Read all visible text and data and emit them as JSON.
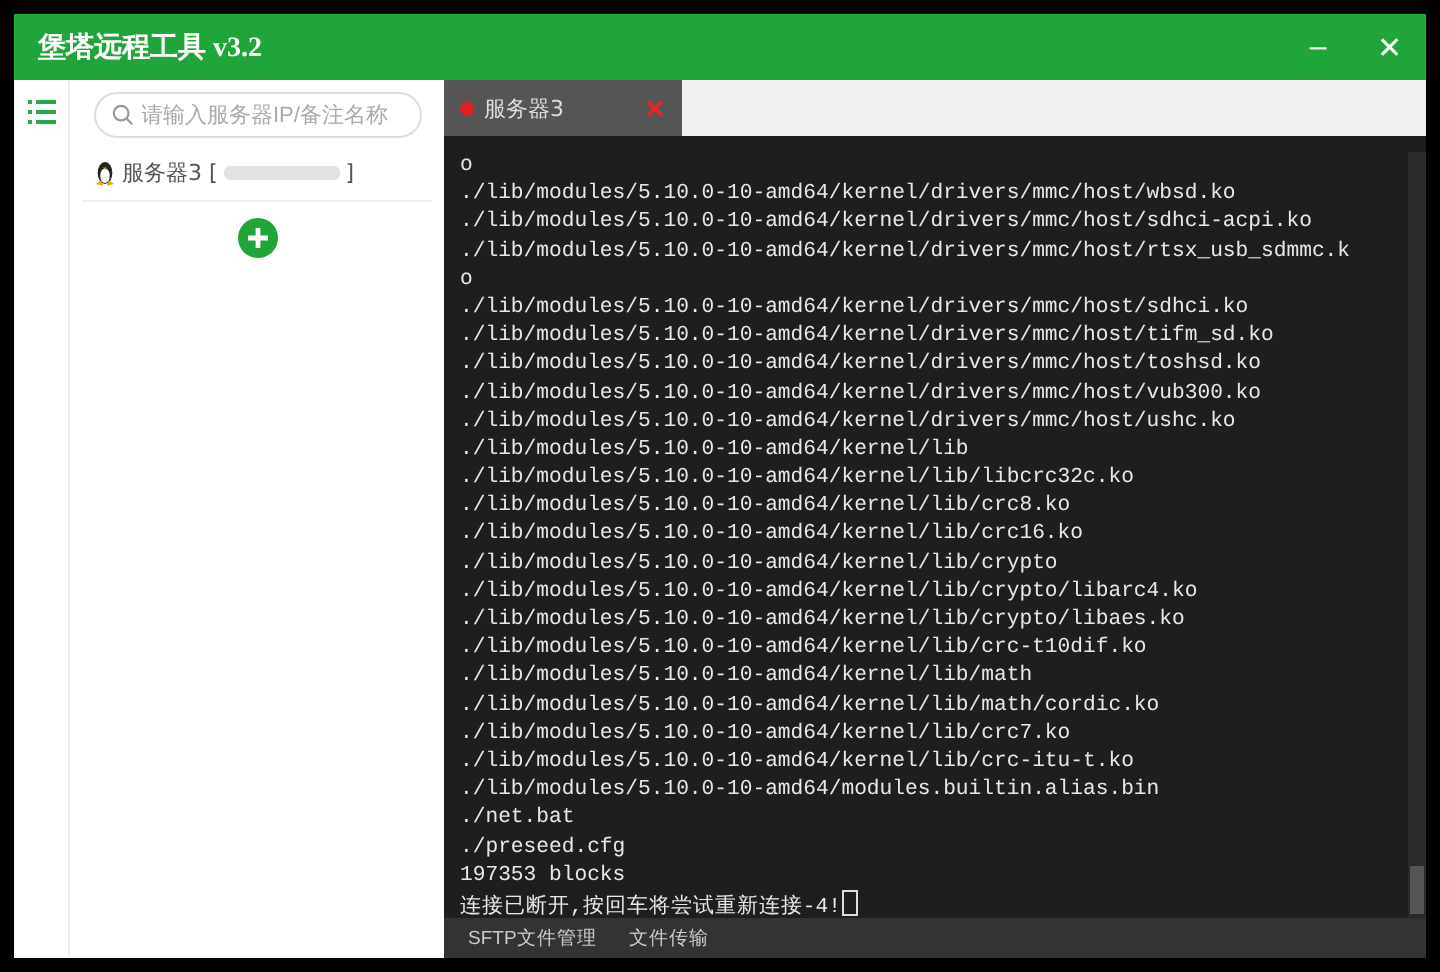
{
  "window": {
    "title": "堡塔远程工具 v3.2",
    "minimize": "–",
    "close": "✕"
  },
  "sidebar": {
    "search": {
      "placeholder": "请输入服务器IP/备注名称"
    },
    "servers": [
      {
        "label": "服务器3 [",
        "suffix": "]",
        "redacted": true
      }
    ]
  },
  "tabs": [
    {
      "label": "服务器3",
      "close": "✕",
      "selected": true
    }
  ],
  "terminal": {
    "lines": [
      "o",
      "./lib/modules/5.10.0-10-amd64/kernel/drivers/mmc/host/wbsd.ko",
      "./lib/modules/5.10.0-10-amd64/kernel/drivers/mmc/host/sdhci-acpi.ko",
      "./lib/modules/5.10.0-10-amd64/kernel/drivers/mmc/host/rtsx_usb_sdmmc.k",
      "o",
      "./lib/modules/5.10.0-10-amd64/kernel/drivers/mmc/host/sdhci.ko",
      "./lib/modules/5.10.0-10-amd64/kernel/drivers/mmc/host/tifm_sd.ko",
      "./lib/modules/5.10.0-10-amd64/kernel/drivers/mmc/host/toshsd.ko",
      "./lib/modules/5.10.0-10-amd64/kernel/drivers/mmc/host/vub300.ko",
      "./lib/modules/5.10.0-10-amd64/kernel/drivers/mmc/host/ushc.ko",
      "./lib/modules/5.10.0-10-amd64/kernel/lib",
      "./lib/modules/5.10.0-10-amd64/kernel/lib/libcrc32c.ko",
      "./lib/modules/5.10.0-10-amd64/kernel/lib/crc8.ko",
      "./lib/modules/5.10.0-10-amd64/kernel/lib/crc16.ko",
      "./lib/modules/5.10.0-10-amd64/kernel/lib/crypto",
      "./lib/modules/5.10.0-10-amd64/kernel/lib/crypto/libarc4.ko",
      "./lib/modules/5.10.0-10-amd64/kernel/lib/crypto/libaes.ko",
      "./lib/modules/5.10.0-10-amd64/kernel/lib/crc-t10dif.ko",
      "./lib/modules/5.10.0-10-amd64/kernel/lib/math",
      "./lib/modules/5.10.0-10-amd64/kernel/lib/math/cordic.ko",
      "./lib/modules/5.10.0-10-amd64/kernel/lib/crc7.ko",
      "./lib/modules/5.10.0-10-amd64/kernel/lib/crc-itu-t.ko",
      "./lib/modules/5.10.0-10-amd64/modules.builtin.alias.bin",
      "./net.bat",
      "./preseed.cfg",
      "197353 blocks",
      "连接已断开,按回车将尝试重新连接-4!"
    ],
    "cursor": true
  },
  "bottom_tabs": [
    "SFTP文件管理",
    "文件传输"
  ]
}
